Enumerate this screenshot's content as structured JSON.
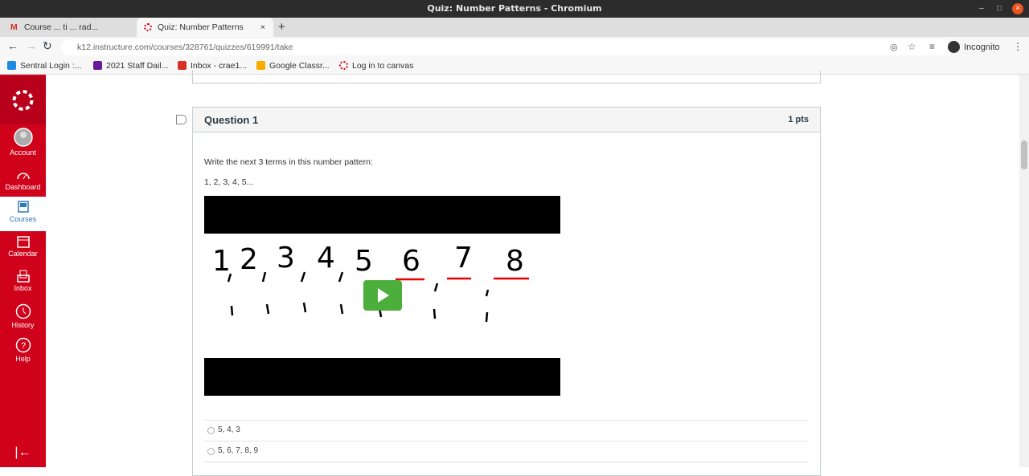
{
  "window": {
    "title": "Quiz: Number Patterns - Chromium"
  },
  "tabs": [
    {
      "label": "Course  ... ti ... rad..."
    },
    {
      "label": "Quiz: Number Patterns"
    }
  ],
  "address": {
    "url": "k12.instructure.com/courses/328761/quizzes/619991/take",
    "incognito_label": "Incognito"
  },
  "bookmarks": [
    {
      "label": "Sentral Login :...",
      "color": "#1e88e5"
    },
    {
      "label": "2021 Staff Dail...",
      "color": "#6a1b9a"
    },
    {
      "label": "Inbox - crae1...",
      "color": "#d93025"
    },
    {
      "label": "Google Classr...",
      "color": "#f9ab00"
    },
    {
      "label": "Log in to canvas",
      "color": "#d0021b"
    }
  ],
  "sidebar": {
    "items": [
      {
        "label": "Account"
      },
      {
        "label": "Dashboard"
      },
      {
        "label": "Courses"
      },
      {
        "label": "Calendar"
      },
      {
        "label": "Inbox"
      },
      {
        "label": "History"
      },
      {
        "label": "Help"
      }
    ]
  },
  "question": {
    "title": "Question 1",
    "points": "1 pts",
    "prompt": "Write the next 3 terms in this number pattern:",
    "sequence": "1, 2, 3, 4, 5...",
    "video_handwriting": [
      "1",
      "2",
      "3",
      "4",
      "5",
      "6",
      "7",
      "8"
    ],
    "answers": [
      "5, 4, 3",
      "5, 6, 7, 8, 9"
    ]
  },
  "colors": {
    "canvas_red": "#d0021b",
    "play_green": "#4cae3b"
  }
}
